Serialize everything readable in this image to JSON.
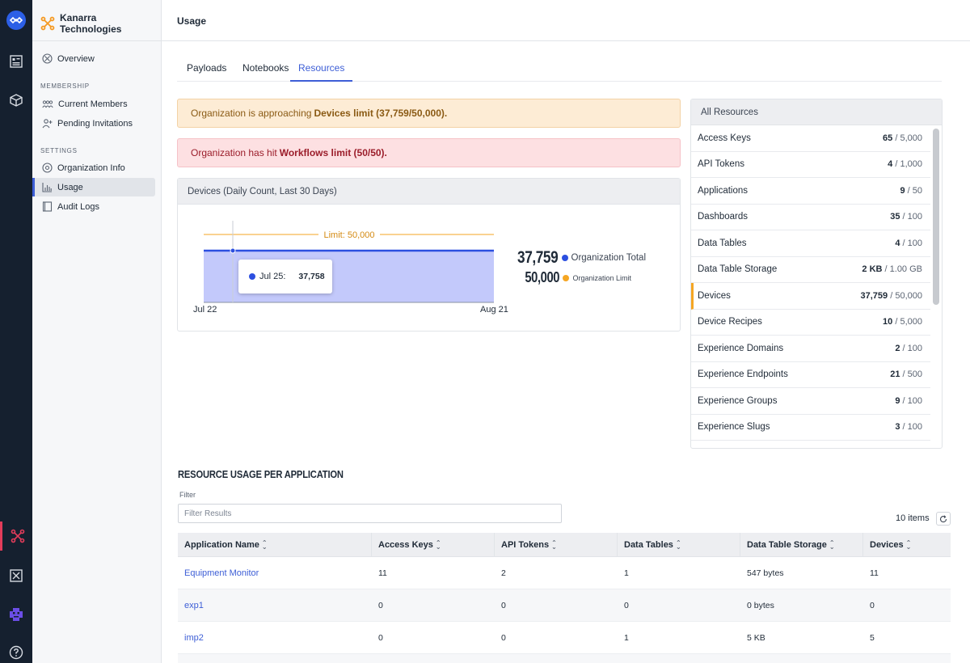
{
  "org": {
    "name": "Kanarra Technologies"
  },
  "sidebar": {
    "overview": "Overview",
    "membership_heading": "MEMBERSHIP",
    "membership": [
      "Current Members",
      "Pending Invitations"
    ],
    "settings_heading": "SETTINGS",
    "settings": [
      "Organization Info",
      "Usage",
      "Audit Logs"
    ]
  },
  "header": {
    "title": "Usage"
  },
  "tabs": [
    "Payloads",
    "Notebooks",
    "Resources"
  ],
  "alerts": {
    "warn_prefix": "Organization is approaching",
    "warn_bold": "Devices limit (37,759/50,000).",
    "err_prefix": "Organization has hit",
    "err_bold": "Workflows limit (50/50)."
  },
  "chart": {
    "title": "Devices (Daily Count, Last 30 Days)",
    "limit_label": "Limit: 50,000",
    "total_value": "37,759",
    "total_label": "Organization Total",
    "limit_value": "50,000",
    "limit_legend": "Organization Limit",
    "tooltip_date": "Jul 25:",
    "tooltip_value": "37,758",
    "x_start": "Jul 22",
    "x_end": "Aug 21",
    "colors": {
      "series": "#2c4fe0",
      "fill": "#c3c9fb",
      "limit": "#f5a623"
    }
  },
  "chart_data": {
    "type": "area",
    "title": "Devices (Daily Count, Last 30 Days)",
    "x_range": [
      "Jul 22",
      "Aug 21"
    ],
    "series": [
      {
        "name": "Organization Total",
        "start": "Jul 22",
        "end": "Aug 21",
        "value": 37759
      }
    ],
    "reference_lines": [
      {
        "label": "Limit: 50,000",
        "value": 50000
      }
    ],
    "tooltip": {
      "x": "Jul 25",
      "y": 37758
    },
    "ylim": [
      0,
      50000
    ]
  },
  "resources": {
    "title": "All Resources",
    "rows": [
      {
        "name": "Access Keys",
        "used": "65",
        "limit": "5,000"
      },
      {
        "name": "API Tokens",
        "used": "4",
        "limit": "1,000"
      },
      {
        "name": "Applications",
        "used": "9",
        "limit": "50"
      },
      {
        "name": "Dashboards",
        "used": "35",
        "limit": "100"
      },
      {
        "name": "Data Tables",
        "used": "4",
        "limit": "100"
      },
      {
        "name": "Data Table Storage",
        "used": "2 KB",
        "limit": "1.00 GB"
      },
      {
        "name": "Devices",
        "used": "37,759",
        "limit": "50,000"
      },
      {
        "name": "Device Recipes",
        "used": "10",
        "limit": "5,000"
      },
      {
        "name": "Experience Domains",
        "used": "2",
        "limit": "100"
      },
      {
        "name": "Experience Endpoints",
        "used": "21",
        "limit": "500"
      },
      {
        "name": "Experience Groups",
        "used": "9",
        "limit": "100"
      },
      {
        "name": "Experience Slugs",
        "used": "3",
        "limit": "100"
      }
    ]
  },
  "app_usage": {
    "title": "RESOURCE USAGE PER APPLICATION",
    "filter_label": "Filter",
    "filter_placeholder": "Filter Results",
    "items_count": "10 items",
    "columns": [
      "Application Name",
      "Access Keys",
      "API Tokens",
      "Data Tables",
      "Data Table Storage",
      "Devices"
    ],
    "rows": [
      [
        "Equipment Monitor",
        "11",
        "2",
        "1",
        "547 bytes",
        "11"
      ],
      [
        "exp1",
        "0",
        "0",
        "0",
        "0 bytes",
        "0"
      ],
      [
        "imp2",
        "0",
        "0",
        "1",
        "5 KB",
        "5"
      ]
    ]
  }
}
